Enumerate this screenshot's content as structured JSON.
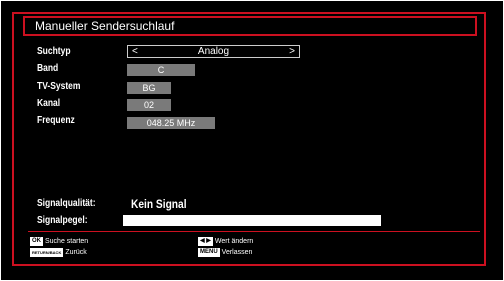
{
  "header": {
    "title": "Manueller Sendersuchlauf"
  },
  "fields": {
    "suchtyp": {
      "label": "Suchtyp",
      "value": "Analog",
      "left_arrow": "<",
      "right_arrow": ">"
    },
    "band": {
      "label": "Band",
      "value": "C"
    },
    "tv_system": {
      "label": "TV-System",
      "value": "BG"
    },
    "kanal": {
      "label": "Kanal",
      "value": "02"
    },
    "frequenz": {
      "label": "Frequenz",
      "value": "048.25 MHz"
    }
  },
  "signal": {
    "quality_label": "Signalqualität:",
    "quality_value": "Kein Signal",
    "level_label": "Signalpegel:"
  },
  "footer": {
    "ok_key": "OK",
    "ok_text": "Suche starten",
    "back_key": "RETURN/BACK",
    "back_text": "Zurück",
    "change_key": "◀ ▶",
    "change_text": "Wert ändern",
    "menu_key": "MENU",
    "menu_text": "Verlassen"
  },
  "colors": {
    "accent": "#cc1020",
    "value_box": "#7a7a7a",
    "background": "#000000"
  }
}
